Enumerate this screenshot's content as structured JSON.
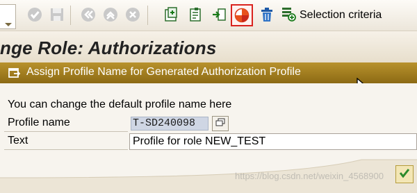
{
  "toolbar": {
    "selection_criteria_label": "Selection criteria",
    "icons": [
      "menu-tab-icon",
      "check-icon",
      "save-icon",
      "back-icon",
      "exit-icon",
      "cancel-icon",
      "create-node-icon",
      "change-node-icon",
      "transfer-icon",
      "profile-status-icon",
      "delete-icon",
      "selection-criteria-icon"
    ]
  },
  "title": {
    "text": "nge Role: Authorizations"
  },
  "dialog": {
    "title": "Assign Profile Name for Generated Authorization Profile",
    "info_text": "You can change the default profile name here",
    "fields": {
      "profile_name_label": "Profile name",
      "profile_name_value": "T-SD240098",
      "text_label": "Text",
      "text_value": "Profile for role NEW_TEST"
    },
    "watermark": "https://blog.csdn.net/weixin_4568900"
  },
  "colors": {
    "dialog_header": "#a07c20",
    "highlight_border": "#d9231e",
    "field_selected": "#cfd6e4"
  }
}
